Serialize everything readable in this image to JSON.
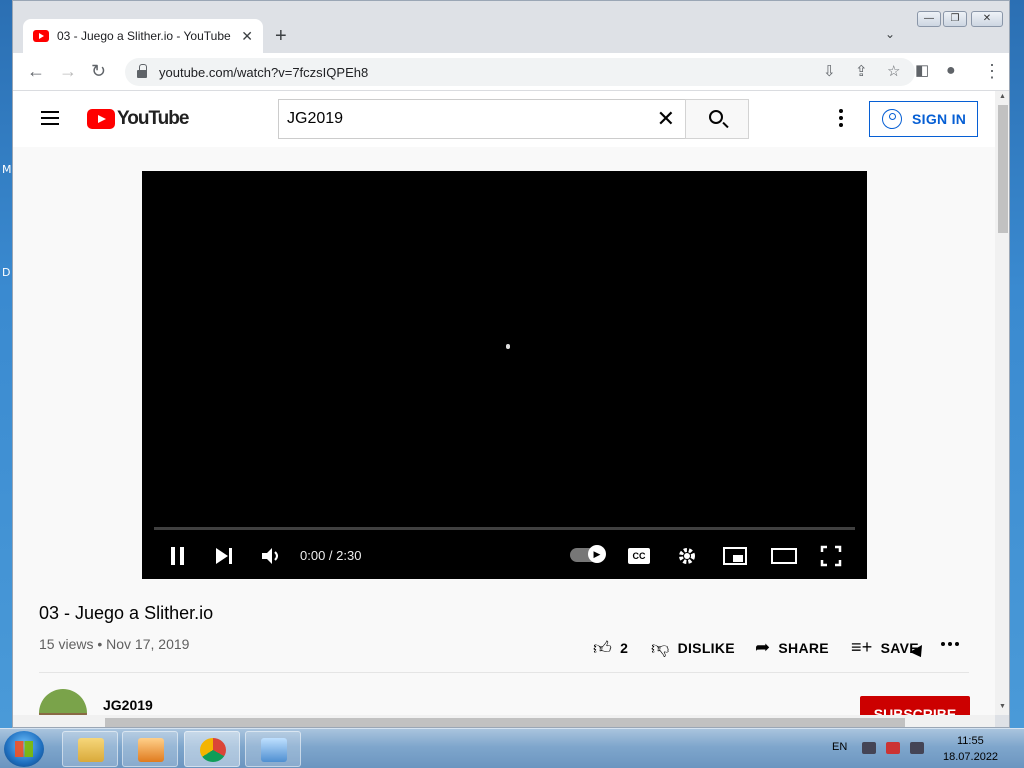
{
  "desktop": {
    "edge_letters": [
      "M",
      "D"
    ]
  },
  "browser": {
    "tab_title": "03 - Juego a Slither.io - YouTube",
    "tab_close": "✕",
    "new_tab": "+",
    "tab_search": "⌄",
    "url": "youtube.com/watch?v=7fczsIQPEh8",
    "window_controls": [
      "—",
      "❐",
      "✕"
    ]
  },
  "youtube": {
    "logo_text": "YouTube",
    "search_value": "JG2019",
    "search_clear": "✕",
    "sign_in": "SIGN IN"
  },
  "player": {
    "time": "0:00 / 2:30",
    "progress": 0,
    "cc_label": "CC"
  },
  "video": {
    "title": "03 - Juego a Slither.io",
    "meta": "15 views • Nov 17, 2019",
    "like_count": "2",
    "dislike_label": "DISLIKE",
    "share_label": "SHARE",
    "save_label": "SAVE",
    "channel_name": "JG2019",
    "subscribe_label": "SUBSCRIBE"
  },
  "taskbar": {
    "language": "EN",
    "time": "11:55",
    "date": "18.07.2022"
  },
  "colors": {
    "brand": "#ff0000",
    "link": "#065fd4",
    "subscribe": "#cc0000"
  }
}
